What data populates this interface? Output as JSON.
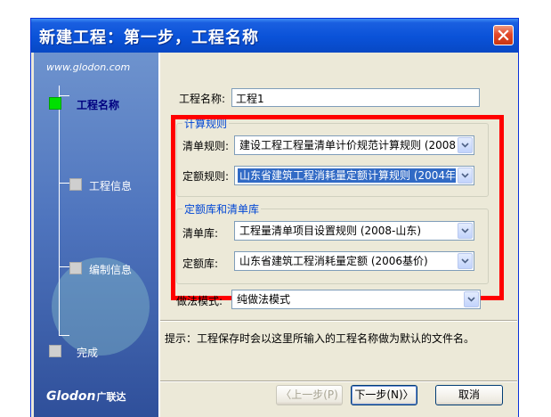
{
  "window": {
    "title": "新建工程：第一步，工程名称"
  },
  "sidebar": {
    "site": "www.glodon.com",
    "steps": [
      {
        "label": "工程名称"
      },
      {
        "label": "工程信息"
      },
      {
        "label": "编制信息"
      },
      {
        "label": "完成"
      }
    ],
    "logo": "Glodon",
    "logo_cn": "广联达"
  },
  "form": {
    "project_name_label": "工程名称:",
    "project_name_value": "工程1",
    "calc_group_title": "计算规则",
    "list_rule_label": "清单规则:",
    "list_rule_value": "建设工程工程量清单计价规范计算规则 (2008-L",
    "quota_rule_label": "定额规则:",
    "quota_rule_value": "山东省建筑工程消耗量定额计算规则 (2004年04",
    "library_group_title": "定额库和清单库",
    "list_lib_label": "清单库:",
    "list_lib_value": "工程量清单项目设置规则 (2008-山东)",
    "quota_lib_label": "定额库:",
    "quota_lib_value": "山东省建筑工程消耗量定额 (2006基价)",
    "method_label": "做法模式:",
    "method_value": "纯做法模式"
  },
  "hint": "提示：工程保存时会以这里所输入的工程名称做为默认的文件名。",
  "buttons": {
    "prev": "〈上一步(P)",
    "next": "下一步(N)〉",
    "cancel": "取消"
  }
}
